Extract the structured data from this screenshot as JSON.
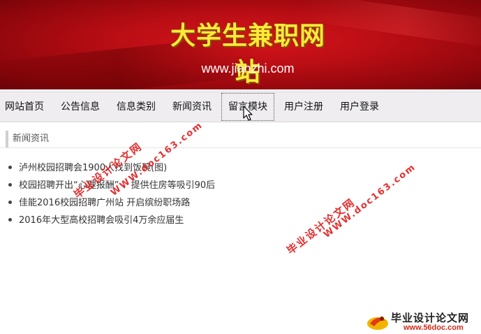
{
  "banner": {
    "title": "大学生兼职网站",
    "url": "www.jianzhi.com"
  },
  "nav": {
    "items": [
      {
        "label": "网站首页"
      },
      {
        "label": "公告信息"
      },
      {
        "label": "信息类别"
      },
      {
        "label": "新闻资讯"
      },
      {
        "label": "留言模块"
      },
      {
        "label": "用户注册"
      },
      {
        "label": "用户登录"
      }
    ]
  },
  "section": {
    "title": "新闻资讯"
  },
  "news": [
    {
      "title": "泸州校园招聘会1900人找到饭碗(图)"
    },
    {
      "title": "校园招聘开出“心理报酬” 、提供住房等吸引90后"
    },
    {
      "title": "佳能2016校园招聘广州站 开启缤纷职场路"
    },
    {
      "title": "2016年大型高校招聘会吸引4万余应届生"
    }
  ],
  "watermarks": {
    "cn": "毕业设计论文网",
    "url": "WWW.doc163.com",
    "corner_cn": "毕业设计论文网",
    "corner_url": "www.56doc.com"
  },
  "colors": {
    "banner_red": "#b80d14",
    "banner_title": "#ffe93a",
    "nav_bg": "#efedf0",
    "watermark_red": "#e02020"
  }
}
